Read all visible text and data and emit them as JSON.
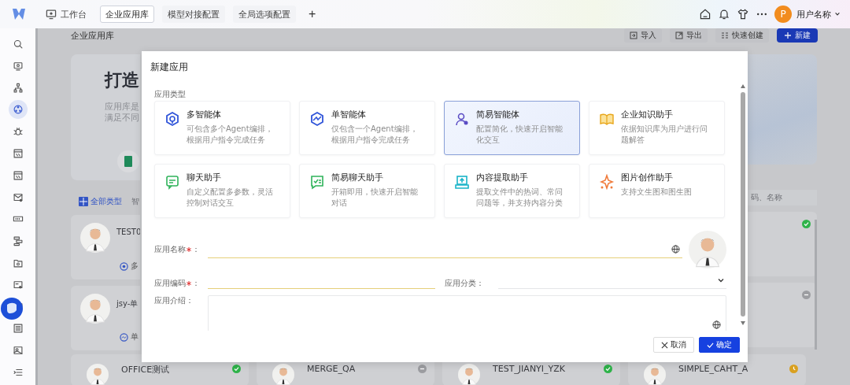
{
  "topbar": {
    "tabs": [
      {
        "label": "工作台",
        "selected": false,
        "kind": "home"
      },
      {
        "label": "企业应用库",
        "selected": true,
        "kind": "plain"
      },
      {
        "label": "模型对接配置",
        "selected": false,
        "kind": "plain"
      },
      {
        "label": "全局选项配置",
        "selected": false,
        "kind": "plain"
      }
    ],
    "add_tab": "+",
    "user": {
      "avatar": "P",
      "name": "用户名称"
    }
  },
  "sidebar": {
    "items": [
      {
        "kind": "search",
        "selected": false
      },
      {
        "kind": "screen",
        "selected": false
      },
      {
        "kind": "org",
        "selected": false
      },
      {
        "kind": "app",
        "selected": true
      },
      {
        "kind": "bug",
        "selected": false
      },
      {
        "kind": "table",
        "selected": false
      },
      {
        "kind": "table",
        "selected": false
      },
      {
        "kind": "mail",
        "selected": false
      },
      {
        "kind": "keyboard",
        "selected": false
      },
      {
        "kind": "flow",
        "selected": false
      },
      {
        "kind": "folder",
        "selected": false
      },
      {
        "kind": "card",
        "selected": false
      },
      {
        "kind": "card",
        "selected": false
      },
      {
        "kind": "list",
        "selected": false
      },
      {
        "kind": "image",
        "selected": false
      },
      {
        "kind": "collapse",
        "selected": false
      }
    ]
  },
  "page": {
    "title": "企业应用库",
    "actions": [
      {
        "label": "导入",
        "kind": "import"
      },
      {
        "label": "导出",
        "kind": "export"
      },
      {
        "label": "快速创建",
        "kind": "quick"
      },
      {
        "label": "新建",
        "kind": "primary"
      }
    ]
  },
  "banner": {
    "title": "打造",
    "lines": [
      "应用库是",
      "满足不同"
    ]
  },
  "filters": {
    "tabs": [
      {
        "label": "全部类型",
        "selected": true
      },
      {
        "label": "智",
        "selected": false
      }
    ],
    "search": {
      "placeholder": "码、名称"
    }
  },
  "apps_left": [
    {
      "name": "TEST0",
      "tag": "多",
      "kind": "multi"
    },
    {
      "name": "jsy-单",
      "tag": "单",
      "kind": "single"
    }
  ],
  "apps_right": [
    {
      "kind": "published"
    },
    {
      "kind": "draft"
    }
  ],
  "apps_bottom": [
    {
      "name": "OFFICE测试",
      "kind": "published"
    },
    {
      "name": "MERGE_QA",
      "kind": "draft"
    },
    {
      "name": "TEST_JIANYI_YZK",
      "kind": "published"
    },
    {
      "name": "SIMPLE_CAHT_A",
      "kind": "pending"
    }
  ],
  "dialog": {
    "title": "新建应用",
    "type_label": "应用类型",
    "types": [
      {
        "title": "多智能体",
        "desc": "可包含多个Agent编排，根据用户指令完成任务",
        "kind": "multi",
        "selected": false
      },
      {
        "title": "单智能体",
        "desc": "仅包含一个Agent编排，根据用户指令完成任务",
        "kind": "single",
        "selected": false
      },
      {
        "title": "简易智能体",
        "desc": "配置简化，快速开启智能化交互",
        "kind": "simple",
        "selected": true
      },
      {
        "title": "企业知识助手",
        "desc": "依据知识库为用户进行问题解答",
        "kind": "knowledge",
        "selected": false
      },
      {
        "title": "聊天助手",
        "desc": "自定义配置多参数，灵活控制对话交互",
        "kind": "chat",
        "selected": false
      },
      {
        "title": "简易聊天助手",
        "desc": "开箱即用，快速开启智能对话",
        "kind": "simple_chat",
        "selected": false
      },
      {
        "title": "内容提取助手",
        "desc": "提取文件中的热词、常问问题等，并支持内容分类",
        "kind": "extract",
        "selected": false
      },
      {
        "title": "图片创作助手",
        "desc": "支持文生图和图生图",
        "kind": "image",
        "selected": false
      }
    ],
    "form": {
      "name": {
        "label": "应用名称",
        "required": true,
        "suffix": "："
      },
      "code": {
        "label": "应用编码",
        "required": true,
        "suffix": "："
      },
      "category": {
        "label": "应用分类",
        "required": false,
        "suffix": "："
      },
      "intro": {
        "label": "应用介绍",
        "required": false,
        "suffix": "："
      }
    },
    "buttons": [
      {
        "label": "取消",
        "kind": "cancel"
      },
      {
        "label": "确定",
        "kind": "primary"
      }
    ]
  }
}
